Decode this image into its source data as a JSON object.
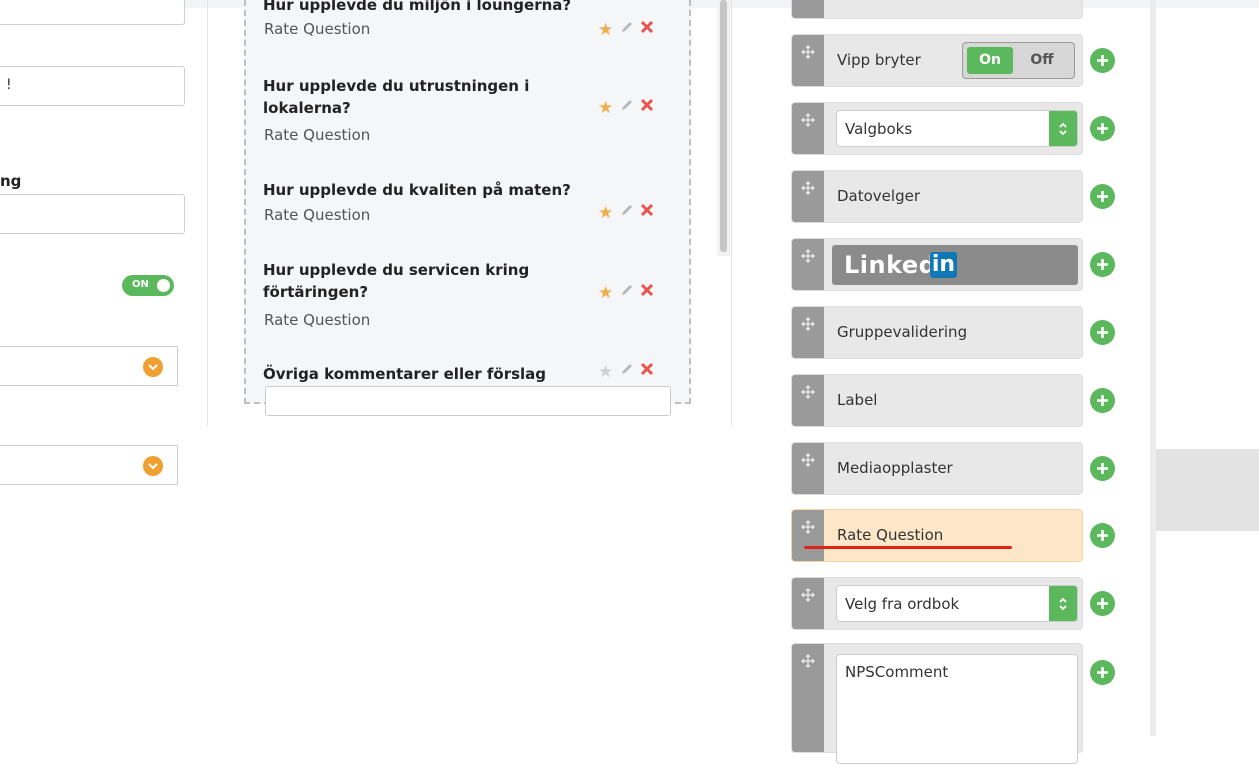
{
  "left_form": {
    "field2_value": "!",
    "heading": "ng",
    "toggle_label": "ON"
  },
  "questions": {
    "items": [
      {
        "title": "Hur upplevde du miljön i loungerna?",
        "type": "Rate Question"
      },
      {
        "title": "Hur upplevde du utrustningen i lokalerna?",
        "type": "Rate Question"
      },
      {
        "title": "Hur upplevde du kvaliten på maten?",
        "type": "Rate Question"
      },
      {
        "title": "Hur upplevde du servicen kring förtäringen?",
        "type": "Rate Question"
      },
      {
        "title": "Övriga kommentarer eller förslag",
        "type": ""
      }
    ]
  },
  "toolbox": {
    "toggle": {
      "label": "Vipp bryter",
      "on": "On",
      "off": "Off"
    },
    "select": {
      "value": "Valgboks"
    },
    "datepicker": {
      "label": "Datovelger"
    },
    "linkedin": {
      "text": "Linked",
      "badge": "in"
    },
    "groupvalidation": {
      "label": "Gruppevalidering"
    },
    "labelitem": {
      "label": "Label"
    },
    "mediaupload": {
      "label": "Mediaopplaster"
    },
    "ratequestion": {
      "label": "Rate Question"
    },
    "dictionary": {
      "value": "Velg fra ordbok"
    },
    "npscomment": {
      "value": "NPSComment"
    }
  },
  "colors": {
    "accent_green": "#5cb85c",
    "accent_orange": "#f0a030",
    "highlight": "#fde7c8",
    "annotation_red": "#e2231a"
  }
}
